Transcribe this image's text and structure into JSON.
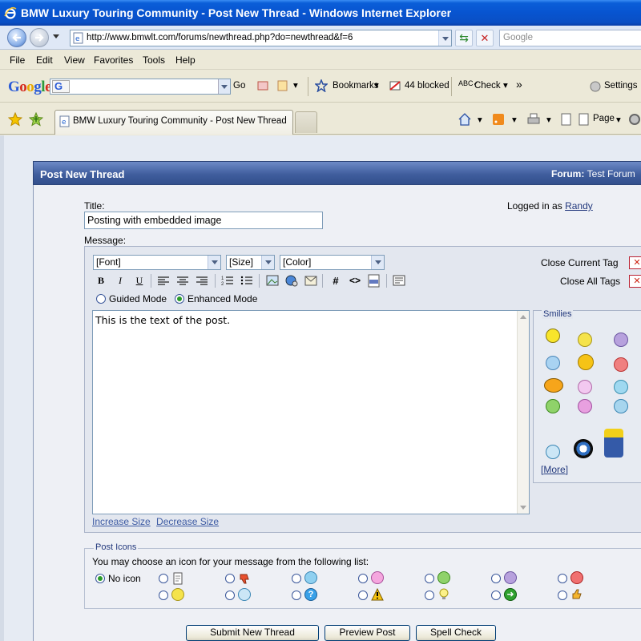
{
  "window": {
    "title": "BMW Luxury Touring Community - Post New Thread - Windows Internet Explorer"
  },
  "address": {
    "url": "http://www.bmwlt.com/forums/newthread.php?do=newthread&f=6",
    "search_placeholder": "Google"
  },
  "menu": [
    "File",
    "Edit",
    "View",
    "Favorites",
    "Tools",
    "Help"
  ],
  "google_toolbar": {
    "go_label": "Go",
    "bookmarks_label": "Bookmarks",
    "blocked_label": "44 blocked",
    "check_label": "Check",
    "settings_label": "Settings",
    "more_label": "»"
  },
  "tabs": {
    "active_tab": "BMW Luxury Touring Community - Post New Thread"
  },
  "commandbar": {
    "page_label": "Page"
  },
  "panel": {
    "heading": "Post New Thread",
    "forum_label": "Forum:",
    "forum_name": "Test Forum"
  },
  "form": {
    "title_label": "Title:",
    "title_value": "Posting with embedded image",
    "logged_prefix": "Logged in as",
    "logged_user": "Randy",
    "message_label": "Message:",
    "font_select": "[Font]",
    "size_select": "[Size]",
    "color_select": "[Color]",
    "close_current_tag": "Close Current Tag",
    "close_all_tags": "Close All Tags",
    "guided_mode": "Guided Mode",
    "enhanced_mode": "Enhanced Mode",
    "message_text": "This is the text of the post.",
    "increase_size": "Increase Size",
    "decrease_size": "Decrease Size",
    "smilies_legend": "Smilies",
    "more_link": "More"
  },
  "post_icons": {
    "legend": "Post Icons",
    "intro": "You may choose an icon for your message from the following list:",
    "no_icon_label": "No icon",
    "selected": "No icon"
  },
  "buttons": {
    "submit": "Submit New Thread",
    "preview": "Preview Post",
    "spell": "Spell Check"
  },
  "colors": {
    "title_bar": "#0854d0",
    "panel_header": "#405e9e",
    "link": "#23397d"
  }
}
